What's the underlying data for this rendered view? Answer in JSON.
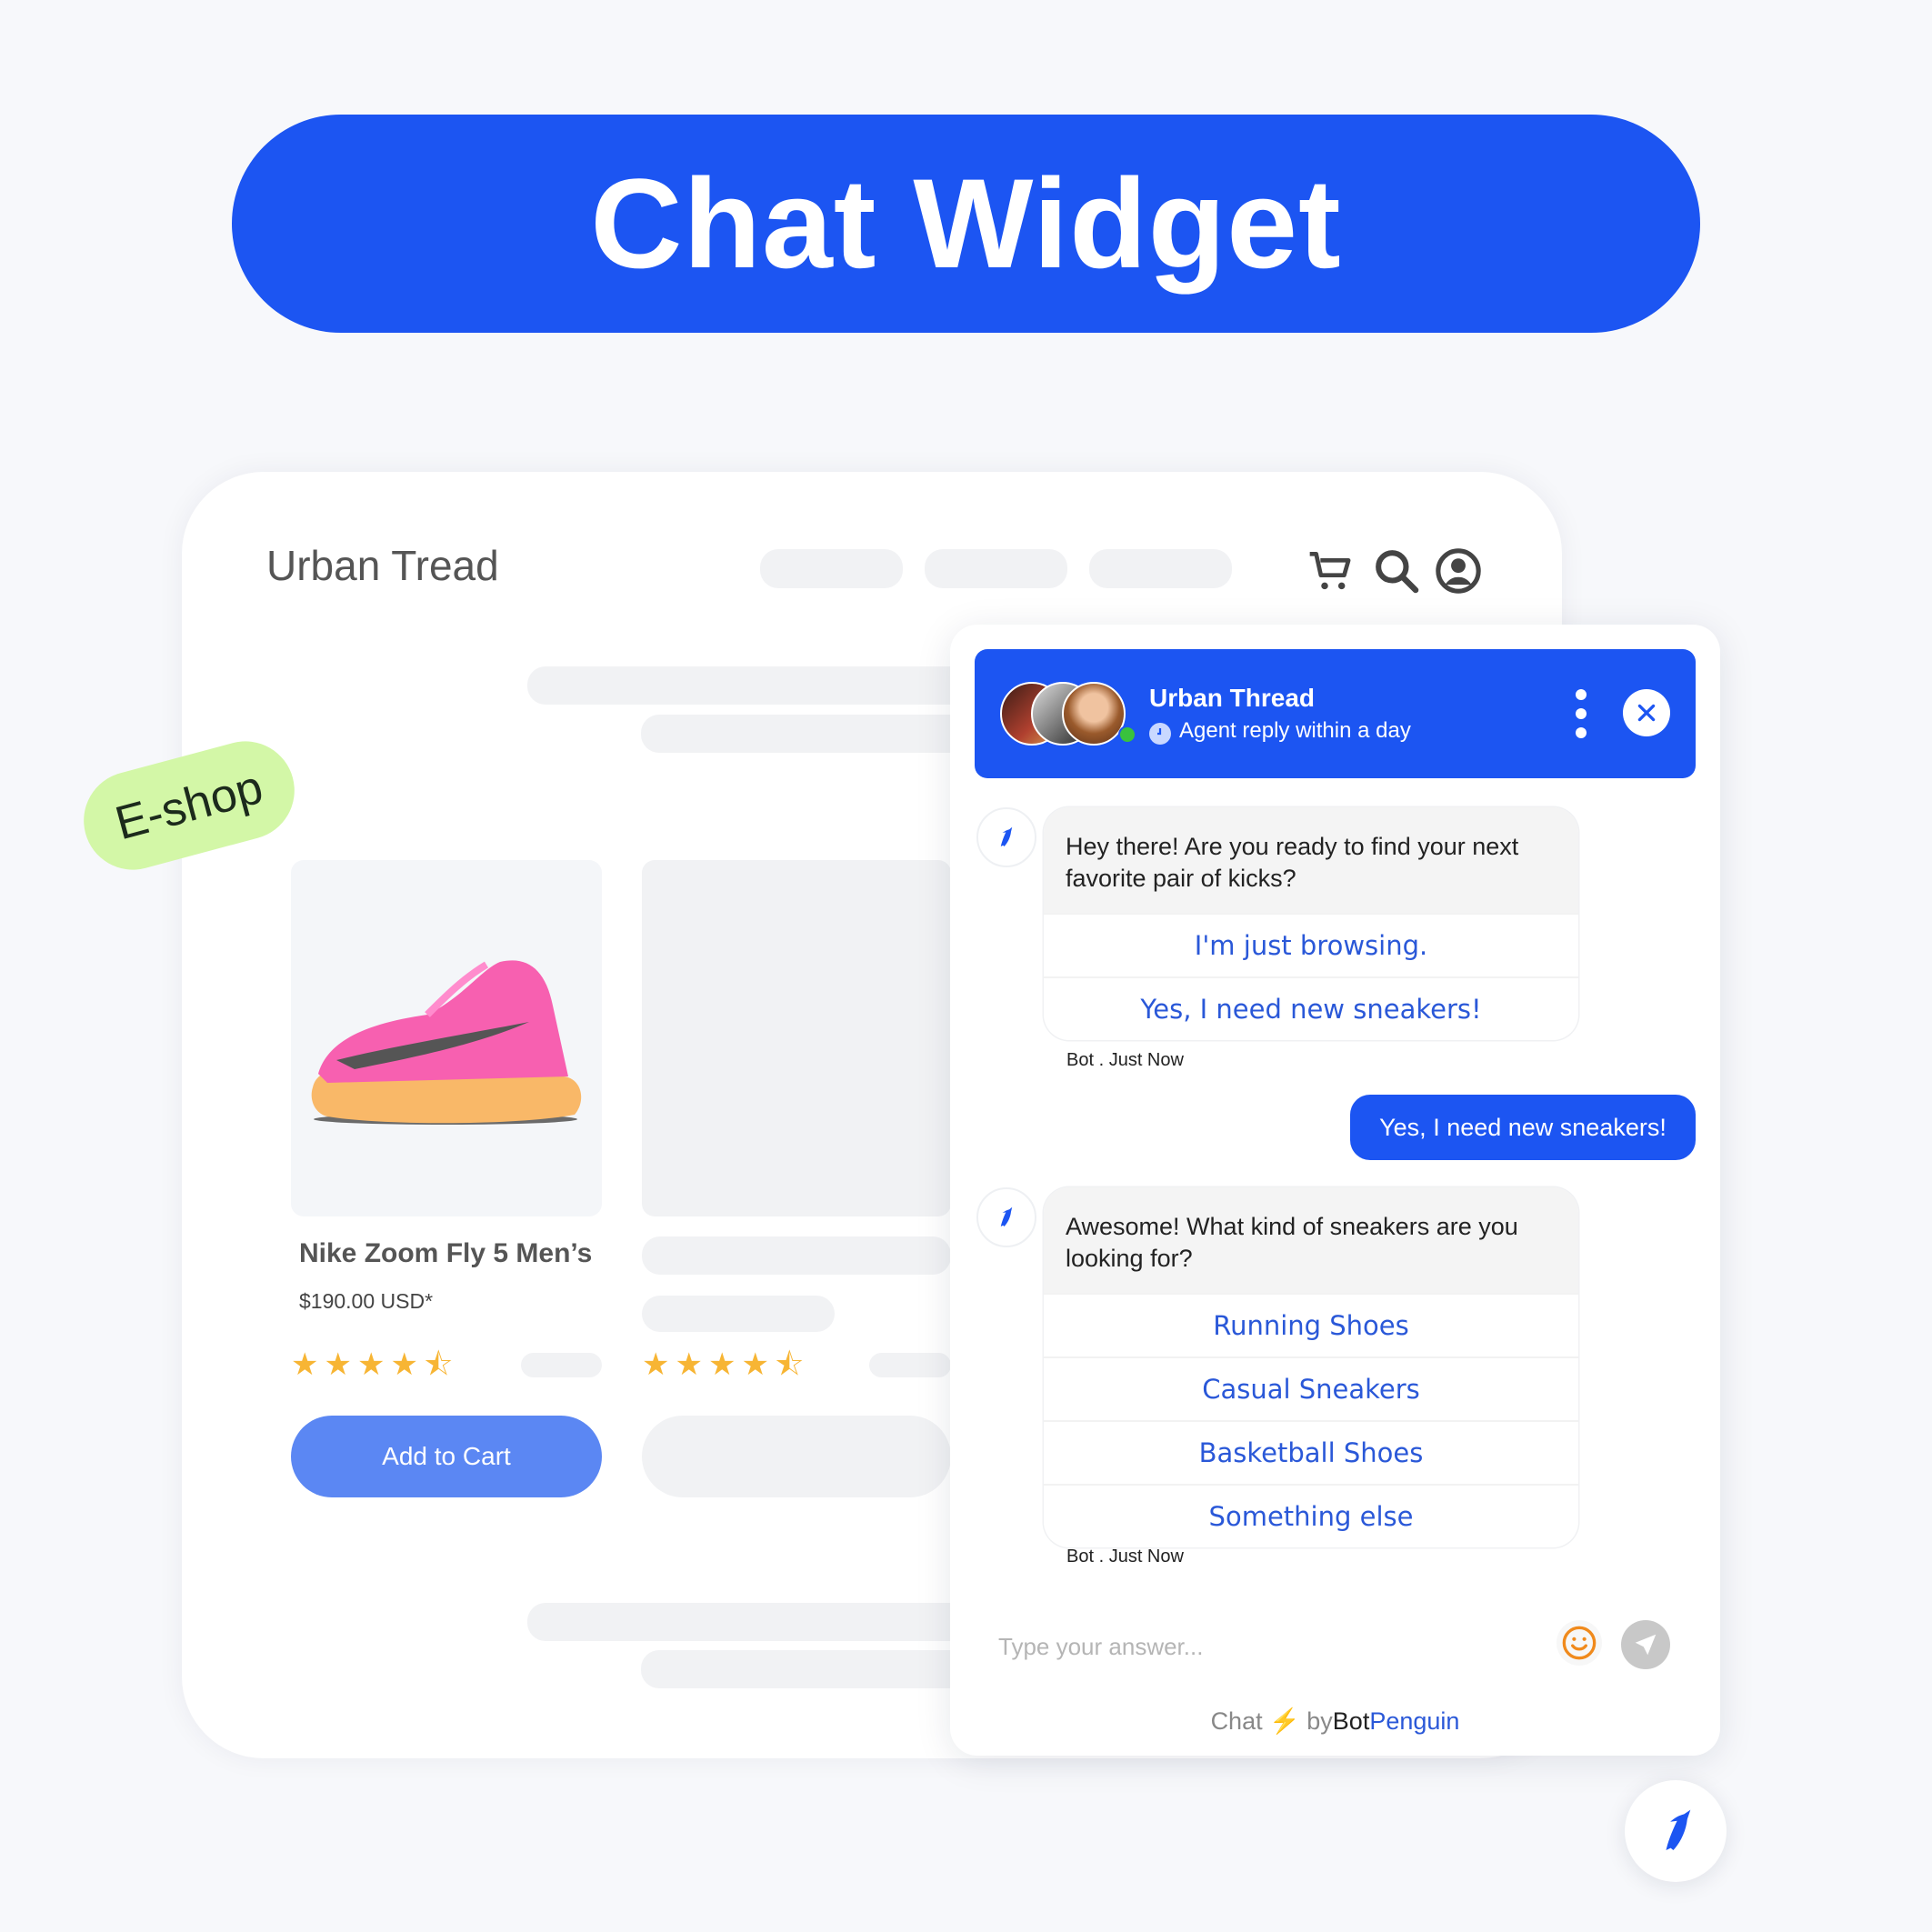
{
  "banner": {
    "title": "Chat Widget"
  },
  "badge": {
    "label": "E-shop"
  },
  "shop": {
    "brand": "Urban Tread",
    "icons": [
      "cart-icon",
      "search-icon",
      "account-icon"
    ],
    "product": {
      "name": "Nike Zoom Fly 5 Men’s",
      "price": "$190.00 USD*",
      "rating": 4.5,
      "rating_max": 5,
      "add_to_cart_label": "Add to Cart"
    },
    "placeholder_product": {
      "rating": 4.5,
      "rating_max": 5
    }
  },
  "chat": {
    "header": {
      "title": "Urban Thread",
      "subtitle": "Agent reply within a day",
      "status": "online"
    },
    "messages": [
      {
        "sender": "bot",
        "text": "Hey there!  Are you ready to find your next favorite pair of kicks?",
        "options": [
          "I'm just browsing.",
          "Yes, I need new sneakers!"
        ],
        "meta": "Bot . Just Now"
      },
      {
        "sender": "user",
        "text": "Yes, I need new sneakers!"
      },
      {
        "sender": "bot",
        "text": "Awesome! What kind of sneakers are you looking for?",
        "options": [
          "Running Shoes",
          "Casual Sneakers",
          "Basketball Shoes",
          "Something else"
        ],
        "meta": "Bot . Just Now"
      }
    ],
    "input": {
      "placeholder": "Type your answer...",
      "value": ""
    },
    "footer": {
      "prefix": "Chat",
      "by": "by",
      "brand_a": "Bot",
      "brand_b": "Penguin"
    }
  },
  "colors": {
    "brand_blue": "#1c55f2",
    "option_blue": "#2a58d8",
    "star": "#f7b534",
    "badge_green": "#d3f7a7",
    "add_to_cart": "#5b87f3",
    "emoji": "#f08a1c"
  }
}
